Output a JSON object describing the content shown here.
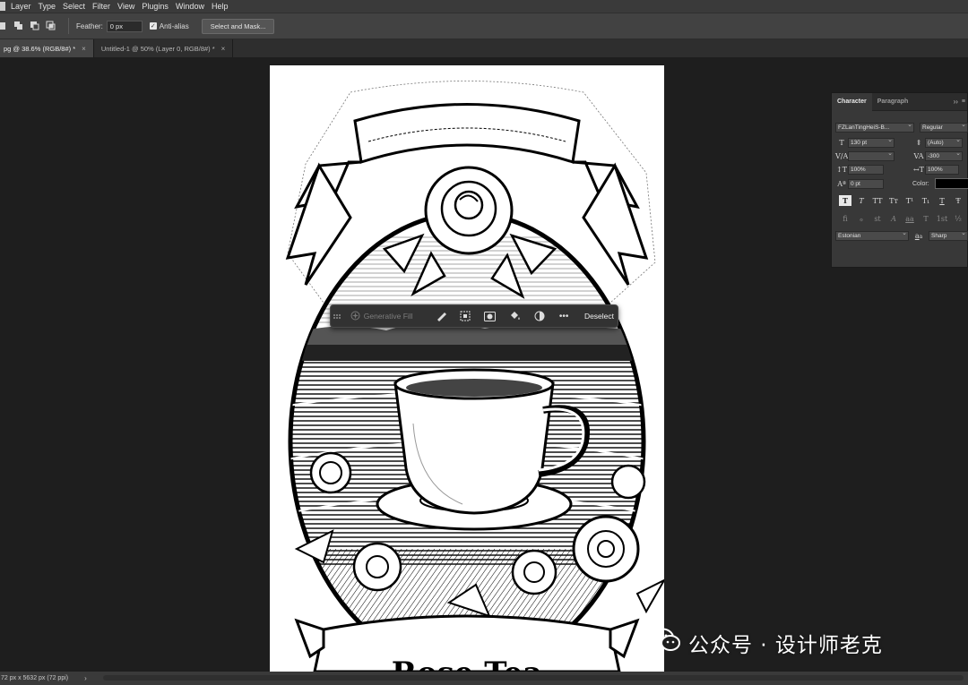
{
  "menu": {
    "items": [
      "Layer",
      "Type",
      "Select",
      "Filter",
      "View",
      "Plugins",
      "Window",
      "Help"
    ]
  },
  "options": {
    "feather_label": "Feather:",
    "feather_value": "0 px",
    "anti_alias_label": "Anti-alias",
    "anti_alias_checked": true,
    "select_mask_label": "Select and Mask..."
  },
  "tabs": [
    {
      "label": "pg @ 38.6% (RGB/8#) *",
      "active": true
    },
    {
      "label": "Untitled-1 @ 50% (Layer 0, RGB/8#) *",
      "active": false
    }
  ],
  "canvas": {
    "artwork_text": "Rose Tea"
  },
  "taskbar": {
    "generative_fill_label": "Generative Fill",
    "deselect_label": "Deselect"
  },
  "character_panel": {
    "tab_character": "Character",
    "tab_paragraph": "Paragraph",
    "font_family": "FZLanTingHeiS-B...",
    "font_style": "Regular",
    "font_size": "130 pt",
    "leading": "(Auto)",
    "kerning": "",
    "tracking": "-300",
    "vertical_scale": "100%",
    "horizontal_scale": "100%",
    "baseline_shift": "0 pt",
    "color_label": "Color:",
    "text_color": "#000000",
    "language": "Estonian",
    "aa_icon_text": "a",
    "antialias": "Sharp",
    "style_buttons": [
      "T",
      "T",
      "TT",
      "Tт",
      "T¹",
      "T₁",
      "T",
      "Ŧ"
    ],
    "opentype_buttons": [
      "fi",
      "ℴ",
      "st",
      "A",
      "aa",
      "T",
      "1st",
      "½"
    ]
  },
  "status": {
    "doc_info": "72 px x 5632 px (72 ppi)"
  },
  "watermark": {
    "text": "公众号 · 设计师老克"
  }
}
